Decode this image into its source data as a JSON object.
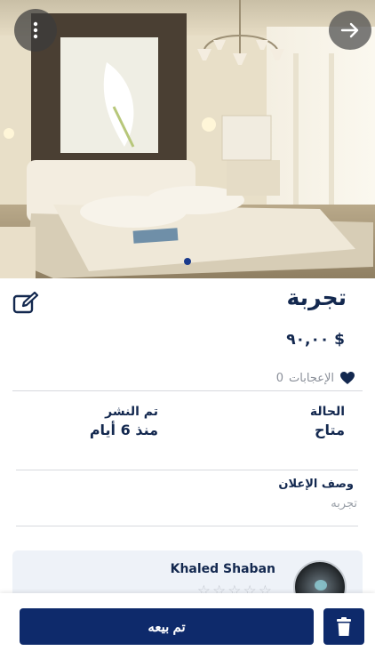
{
  "hero": {
    "image_alt": "bedroom",
    "menu_icon": "vertical-dots-icon",
    "forward_icon": "arrow-right-icon",
    "page_indicator": {
      "count": 1,
      "active": 0
    }
  },
  "listing": {
    "title": "تجربة",
    "price": "$ ٩٠,٠٠",
    "likes_count": "0",
    "likes_label": "الإعجابات",
    "edit_icon": "edit-icon",
    "heart_icon": "heart-icon"
  },
  "info": {
    "status_label": "الحالة",
    "status_value": "متاح",
    "published_label": "تم النشر",
    "published_value": "منذ 6 أيام"
  },
  "description": {
    "label": "وصف الإعلان",
    "value": "تجربه"
  },
  "seller": {
    "name": "Khaled Shaban",
    "stars": "☆☆☆☆☆"
  },
  "actions": {
    "sold_label": "تم بيعه",
    "delete_icon": "trash-icon"
  },
  "colors": {
    "primary": "#0e2a6b",
    "text": "#13284f",
    "muted": "#8a8f99"
  }
}
